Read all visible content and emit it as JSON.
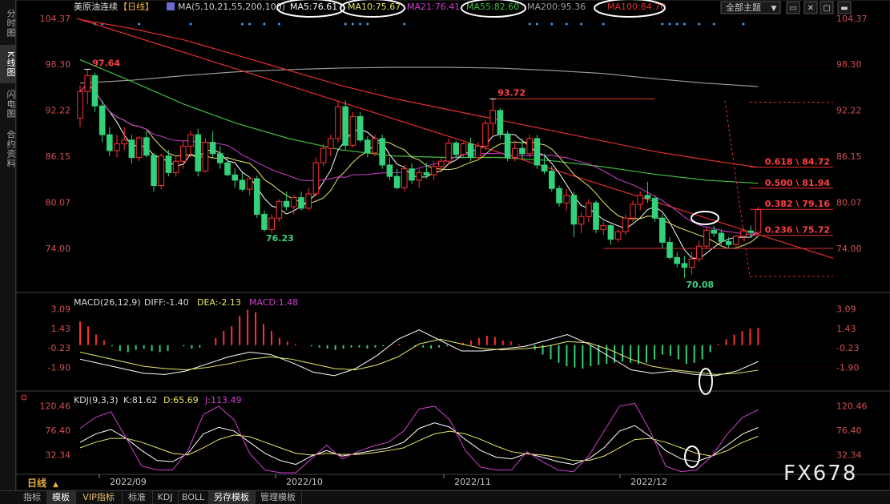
{
  "sidebar": {
    "tabs": [
      {
        "label": "分时图",
        "active": false
      },
      {
        "label": "K线图",
        "active": true
      },
      {
        "label": "闪电图",
        "active": false
      },
      {
        "label": "合约资料",
        "active": false
      }
    ]
  },
  "header": {
    "title": "美原油连续",
    "period": "【日线】",
    "ma_params": "MA(5,10,21,55,200,100)",
    "ma5": "MA5:76.61",
    "ma10": "MA10:75.67",
    "ma21": "MA21:76.41",
    "ma55": "MA55:82.60",
    "ma200": "MA200:95.36",
    "ma100": "MA100:84.70",
    "theme_select": "全部主题",
    "colors": {
      "ma5": "#ffffff",
      "ma10": "#e8e86a",
      "ma21": "#d040d0",
      "ma55": "#40c040",
      "ma200": "#a0a0a0",
      "ma100": "#e03030"
    }
  },
  "macd_header": {
    "params": "MACD(26,12,9)",
    "diff": "DIFF:-1.40",
    "dea": "DEA:-2.13",
    "macd": "MACD:1.48"
  },
  "kdj_header": {
    "params": "KDJ(9,3,3)",
    "k": "K:81.62",
    "d": "D:65.69",
    "j": "J:113.49"
  },
  "period_label": "日线",
  "bottom_tabs": [
    {
      "label": "指标",
      "active": false,
      "vip": false
    },
    {
      "label": "模板",
      "active": true,
      "vip": false
    },
    {
      "label": "VIP指标",
      "active": false,
      "vip": true
    },
    {
      "label": "标准",
      "active": false,
      "vip": false
    },
    {
      "label": "KDJ",
      "active": false,
      "vip": false
    },
    {
      "label": "BOLL",
      "active": false,
      "vip": false
    },
    {
      "label": "另存模板",
      "active": true,
      "vip": false
    },
    {
      "label": "管理模板",
      "active": false,
      "vip": false
    }
  ],
  "watermark": "FX678",
  "chart_data": [
    {
      "type": "candlestick",
      "title": "美原油连续【日线】",
      "y_ticks": [
        "104.37",
        "98.30",
        "92.22",
        "86.15",
        "80.07",
        "74.00"
      ],
      "ylim": [
        68.5,
        105.3
      ],
      "x_ticks": [
        "2022/09",
        "2022/10",
        "2022/11",
        "2022/12"
      ],
      "ohlc": [
        [
          91.2,
          95.5,
          90.0,
          94.7
        ],
        [
          94.7,
          97.64,
          93.0,
          96.8
        ],
        [
          96.8,
          97.2,
          92.0,
          92.8
        ],
        [
          92.8,
          93.5,
          88.0,
          89.0
        ],
        [
          89.0,
          90.0,
          86.2,
          86.9
        ],
        [
          86.9,
          89.0,
          86.0,
          87.8
        ],
        [
          87.8,
          90.0,
          87.0,
          88.3
        ],
        [
          88.3,
          89.0,
          85.2,
          86.0
        ],
        [
          86.0,
          88.8,
          85.5,
          88.6
        ],
        [
          88.6,
          89.5,
          86.0,
          86.3
        ],
        [
          86.3,
          86.6,
          81.5,
          82.3
        ],
        [
          82.3,
          86.5,
          81.8,
          86.2
        ],
        [
          86.2,
          87.0,
          83.5,
          84.0
        ],
        [
          84.0,
          86.2,
          83.5,
          85.5
        ],
        [
          85.5,
          88.2,
          84.5,
          87.5
        ],
        [
          87.5,
          89.5,
          86.0,
          89.0
        ],
        [
          89.0,
          89.8,
          83.5,
          84.2
        ],
        [
          84.2,
          88.5,
          84.0,
          88.0
        ],
        [
          88.0,
          89.5,
          86.0,
          86.5
        ],
        [
          86.5,
          87.5,
          84.5,
          85.3
        ],
        [
          85.3,
          86.0,
          83.5,
          83.7
        ],
        [
          83.7,
          84.6,
          82.0,
          83.0
        ],
        [
          83.0,
          84.0,
          81.5,
          81.8
        ],
        [
          81.8,
          83.5,
          81.0,
          83.2
        ],
        [
          83.2,
          83.6,
          78.0,
          78.5
        ],
        [
          78.5,
          79.0,
          76.23,
          76.5
        ],
        [
          76.5,
          78.5,
          76.0,
          78.0
        ],
        [
          78.0,
          80.5,
          77.5,
          80.2
        ],
        [
          80.2,
          81.5,
          79.0,
          79.5
        ],
        [
          79.5,
          81.0,
          78.5,
          80.7
        ],
        [
          80.7,
          81.5,
          79.0,
          79.3
        ],
        [
          79.3,
          82.0,
          79.0,
          81.2
        ],
        [
          81.2,
          86.0,
          80.8,
          85.3
        ],
        [
          85.3,
          87.8,
          84.8,
          87.2
        ],
        [
          87.2,
          89.0,
          86.2,
          88.5
        ],
        [
          88.5,
          93.5,
          88.0,
          92.7
        ],
        [
          92.7,
          93.5,
          87.0,
          87.6
        ],
        [
          87.6,
          92.0,
          87.3,
          91.4
        ],
        [
          91.4,
          92.0,
          88.0,
          88.3
        ],
        [
          88.3,
          88.8,
          86.0,
          86.6
        ],
        [
          86.6,
          89.0,
          86.2,
          88.5
        ],
        [
          88.5,
          89.0,
          84.5,
          85.0
        ],
        [
          85.0,
          86.0,
          83.0,
          83.5
        ],
        [
          83.5,
          84.5,
          81.8,
          82.0
        ],
        [
          82.0,
          85.0,
          81.5,
          84.5
        ],
        [
          84.5,
          85.2,
          82.5,
          83.0
        ],
        [
          83.0,
          84.5,
          82.0,
          84.0
        ],
        [
          84.0,
          85.3,
          83.2,
          83.7
        ],
        [
          83.7,
          85.5,
          83.0,
          84.8
        ],
        [
          84.8,
          86.0,
          84.2,
          85.5
        ],
        [
          85.5,
          88.5,
          85.0,
          87.9
        ],
        [
          87.9,
          88.2,
          86.0,
          86.4
        ],
        [
          86.4,
          88.0,
          86.0,
          87.8
        ],
        [
          87.8,
          88.6,
          85.5,
          86.0
        ],
        [
          86.0,
          88.0,
          85.8,
          87.5
        ],
        [
          87.5,
          91.0,
          87.0,
          90.5
        ],
        [
          90.5,
          93.72,
          89.0,
          92.2
        ],
        [
          92.2,
          92.5,
          88.5,
          89.1
        ],
        [
          89.1,
          89.5,
          85.5,
          86.0
        ],
        [
          86.0,
          88.0,
          85.5,
          87.2
        ],
        [
          87.2,
          88.5,
          85.8,
          86.5
        ],
        [
          86.5,
          89.0,
          86.0,
          88.5
        ],
        [
          88.5,
          89.0,
          84.5,
          85.0
        ],
        [
          85.0,
          86.5,
          83.8,
          84.2
        ],
        [
          84.2,
          84.9,
          81.5,
          81.9
        ],
        [
          81.9,
          82.3,
          79.5,
          80.0
        ],
        [
          80.0,
          81.8,
          79.0,
          81.0
        ],
        [
          81.0,
          81.5,
          75.5,
          77.2
        ],
        [
          77.2,
          78.8,
          76.0,
          78.2
        ],
        [
          78.2,
          80.5,
          77.5,
          80.0
        ],
        [
          80.0,
          80.3,
          76.0,
          76.5
        ],
        [
          76.5,
          77.5,
          75.8,
          77.0
        ],
        [
          77.0,
          77.2,
          74.5,
          75.2
        ],
        [
          75.2,
          76.5,
          74.8,
          76.2
        ],
        [
          76.2,
          78.5,
          75.8,
          78.0
        ],
        [
          78.0,
          80.3,
          77.5,
          79.8
        ],
        [
          79.8,
          81.5,
          79.0,
          81.0
        ],
        [
          81.0,
          82.8,
          80.0,
          80.6
        ],
        [
          80.6,
          81.0,
          77.5,
          78.0
        ],
        [
          78.0,
          78.5,
          74.0,
          74.8
        ],
        [
          74.8,
          75.5,
          72.5,
          72.8
        ],
        [
          72.8,
          73.5,
          71.5,
          72.0
        ],
        [
          72.0,
          73.0,
          70.08,
          71.5
        ],
        [
          71.5,
          73.5,
          70.5,
          72.6
        ],
        [
          72.6,
          75.0,
          72.2,
          74.3
        ],
        [
          74.3,
          76.8,
          74.0,
          76.4
        ],
        [
          76.4,
          77.0,
          75.5,
          76.0
        ],
        [
          76.0,
          76.5,
          74.5,
          74.9
        ],
        [
          74.9,
          75.5,
          74.0,
          74.5
        ],
        [
          74.5,
          75.8,
          74.2,
          75.6
        ],
        [
          75.6,
          76.8,
          75.0,
          76.3
        ],
        [
          76.3,
          77.0,
          75.5,
          76.1
        ],
        [
          76.1,
          79.5,
          76.0,
          79.1
        ]
      ],
      "annotations": [
        {
          "text": "97.64",
          "index": 1,
          "value": 97.64,
          "kind": "high"
        },
        {
          "text": "93.72",
          "index": 56,
          "value": 93.72,
          "kind": "high"
        },
        {
          "text": "76.23",
          "index": 25,
          "value": 76.23,
          "kind": "low"
        },
        {
          "text": "70.08",
          "index": 82,
          "value": 70.08,
          "kind": "low"
        }
      ],
      "fibonacci": [
        {
          "label": "0.618 \\ 84.72",
          "value": 84.72
        },
        {
          "label": "0.500 \\ 81.94",
          "value": 81.94
        },
        {
          "label": "0.382 \\ 79.16",
          "value": 79.16
        },
        {
          "label": "0.236 \\ 75.72",
          "value": 75.72
        }
      ],
      "channel_lines": [
        93.72,
        74.0
      ],
      "ma_series": [
        {
          "name": "MA200",
          "values": [
            95.8,
            96.2,
            96.8,
            97.3,
            97.6,
            97.8,
            97.9,
            97.9,
            97.8,
            97.5,
            97.1,
            96.4,
            95.8,
            95.36
          ]
        },
        {
          "name": "MA100",
          "values": [
            104.2,
            103.0,
            101.5,
            99.5,
            97.5,
            95.5,
            93.8,
            92.4,
            91.0,
            89.6,
            88.2,
            86.8,
            85.7,
            84.7
          ]
        },
        {
          "name": "MA55",
          "values": [
            98.9,
            96.0,
            93.0,
            90.5,
            88.5,
            87.0,
            86.2,
            86.0,
            86.0,
            85.6,
            84.8,
            83.8,
            83.0,
            82.6
          ]
        },
        {
          "name": "Downtrend",
          "values": [
            104.37,
            72.7
          ]
        }
      ]
    },
    {
      "type": "bar",
      "title": "MACD(26,12,9)",
      "y_ticks": [
        "3.09",
        "1.43",
        "-0.23",
        "-1.90"
      ],
      "ylim": [
        -3.5,
        3.6
      ],
      "series": [
        {
          "name": "DIFF",
          "values": [
            -1.2,
            -1.6,
            -2.0,
            -2.4,
            -2.5,
            -2.2,
            -1.6,
            -1.0,
            -0.6,
            -0.8,
            -1.5,
            -2.3,
            -2.6,
            -2.0,
            -0.9,
            0.5,
            1.3,
            0.4,
            -0.5,
            -0.5,
            -0.3,
            -0.1,
            0.4,
            0.9,
            0.1,
            -1.0,
            -2.1,
            -2.4,
            -2.2,
            -2.5,
            -2.6,
            -2.2,
            -1.4
          ]
        },
        {
          "name": "DEA",
          "values": [
            -0.6,
            -1.0,
            -1.4,
            -1.8,
            -2.0,
            -2.1,
            -1.9,
            -1.6,
            -1.2,
            -1.0,
            -1.2,
            -1.6,
            -2.0,
            -2.1,
            -1.7,
            -1.0,
            0.1,
            0.5,
            0.1,
            -0.3,
            -0.4,
            -0.3,
            -0.1,
            0.3,
            0.2,
            -0.4,
            -1.2,
            -1.8,
            -2.1,
            -2.3,
            -2.5,
            -2.4,
            -2.13
          ]
        },
        {
          "name": "MACD",
          "values": [
            2.0,
            1.6,
            0.9,
            0.4,
            -0.1,
            -0.5,
            -0.6,
            -0.4,
            -0.3,
            -0.5,
            -0.6,
            -0.5,
            0.0,
            -0.1,
            -0.3,
            -0.2,
            0.0,
            0.6,
            1.2,
            1.6,
            2.5,
            3.0,
            2.8,
            1.8,
            1.2,
            0.6,
            0.3,
            0.1,
            0.0,
            -0.1,
            -0.2,
            -0.3,
            -0.4,
            -0.3,
            -0.2,
            -0.2,
            -0.3,
            -0.2,
            -0.1,
            0.0,
            0.1,
            0.0,
            -0.1,
            -0.2,
            -0.3,
            -0.2,
            -0.1,
            0.0,
            0.2,
            0.4,
            0.6,
            0.8,
            0.7,
            0.4,
            0.3,
            0.1,
            -0.1,
            -0.4,
            -0.8,
            -1.2,
            -1.5,
            -1.8,
            -1.9,
            -2.0,
            -1.8,
            -1.7,
            -1.6,
            -1.5,
            -1.4,
            -1.5,
            -1.6,
            -1.5,
            -1.2,
            -0.8,
            -0.9,
            -1.2,
            -1.6,
            -1.5,
            -1.2,
            -0.6,
            0.1,
            0.5,
            0.9,
            1.2,
            1.4,
            1.48
          ]
        }
      ]
    },
    {
      "type": "line",
      "title": "KDJ(9,3,3)",
      "y_ticks": [
        "120.46",
        "76.40",
        "32.34"
      ],
      "ylim": [
        0,
        130
      ],
      "series": [
        {
          "name": "K",
          "values": [
            55,
            70,
            78,
            62,
            40,
            22,
            20,
            35,
            70,
            82,
            75,
            55,
            35,
            22,
            15,
            30,
            40,
            30,
            35,
            40,
            45,
            55,
            80,
            90,
            82,
            60,
            40,
            28,
            25,
            35,
            28,
            20,
            15,
            25,
            45,
            75,
            85,
            65,
            40,
            25,
            20,
            30,
            50,
            70,
            81.62
          ]
        },
        {
          "name": "D",
          "values": [
            45,
            55,
            62,
            62,
            55,
            45,
            35,
            32,
            45,
            60,
            68,
            65,
            55,
            45,
            35,
            32,
            35,
            33,
            33,
            36,
            40,
            45,
            58,
            70,
            75,
            70,
            60,
            48,
            38,
            34,
            32,
            28,
            22,
            22,
            30,
            45,
            60,
            62,
            55,
            45,
            35,
            30,
            40,
            55,
            65.69
          ]
        },
        {
          "name": "J",
          "values": [
            80,
            100,
            110,
            62,
            12,
            5,
            5,
            40,
            105,
            120,
            95,
            35,
            5,
            0,
            0,
            25,
            50,
            25,
            38,
            48,
            55,
            75,
            115,
            120,
            95,
            40,
            10,
            5,
            5,
            38,
            20,
            5,
            2,
            30,
            75,
            120,
            125,
            75,
            12,
            2,
            5,
            30,
            70,
            100,
            113.49
          ]
        }
      ]
    }
  ]
}
